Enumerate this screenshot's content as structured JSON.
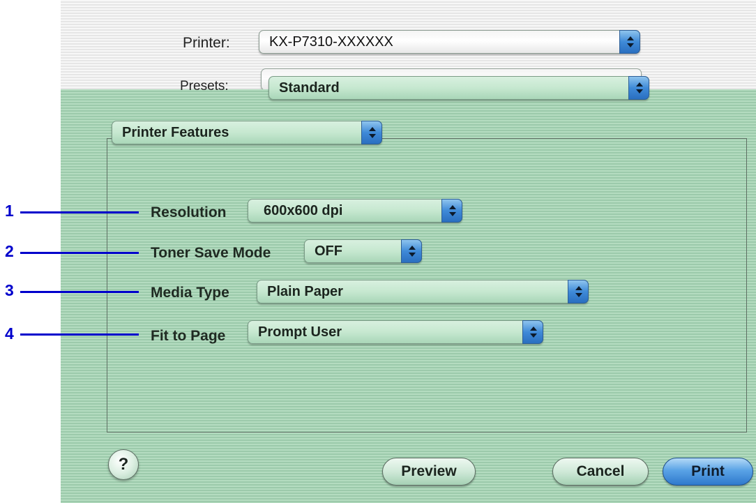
{
  "printer": {
    "label": "Printer:",
    "value": "KX-P7310-XXXXXX"
  },
  "presets": {
    "label": "Presets:",
    "value": "Standard"
  },
  "panel_select": {
    "value": "Printer Features"
  },
  "features": [
    {
      "callout": "1",
      "label": "Resolution",
      "value": "600x600 dpi"
    },
    {
      "callout": "2",
      "label": "Toner Save Mode",
      "value": "OFF"
    },
    {
      "callout": "3",
      "label": "Media Type",
      "value": "Plain Paper"
    },
    {
      "callout": "4",
      "label": "Fit to Page",
      "value": "Prompt User"
    }
  ],
  "buttons": {
    "help": "?",
    "preview": "Preview",
    "cancel": "Cancel",
    "print": "Print"
  },
  "colors": {
    "callout": "#0000cc",
    "sheet_stripe_light": "#b4dcc0",
    "sheet_stripe_dark": "#9ccaab",
    "arrow_blue": "#3f8ad8"
  }
}
